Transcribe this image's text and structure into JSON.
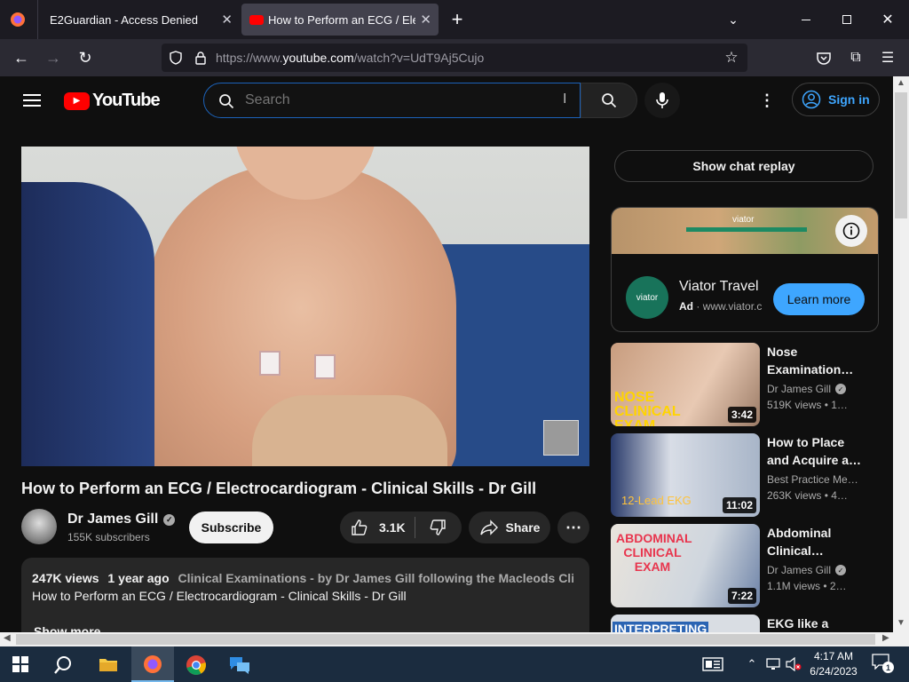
{
  "browser": {
    "tabs": [
      {
        "title": "E2Guardian - Access Denied"
      },
      {
        "title": "How to Perform an ECG / Electr"
      }
    ],
    "url_prefix": "https://www.",
    "url_host": "youtube.com",
    "url_rest": "/watch?v=UdT9Aj5Cujo"
  },
  "youtube": {
    "logo_text": "YouTube",
    "search_placeholder": "Search",
    "sign_in": "Sign in",
    "video_title": "How to Perform an ECG / Electrocardiogram - Clinical Skills - Dr Gill",
    "channel_name": "Dr James Gill",
    "subscribers": "155K subscribers",
    "subscribe": "Subscribe",
    "likes": "3.1K",
    "share": "Share",
    "views": "247K views",
    "age": "1 year ago",
    "desc_tags": "Clinical Examinations - by Dr James Gill following the Macleods Clinical E",
    "desc_line": "How to Perform an ECG / Electrocardiogram - Clinical Skills - Dr Gill",
    "show_more": "Show more",
    "chat_replay": "Show chat replay",
    "ad": {
      "brand": "Viator Travel",
      "label": "Ad",
      "domain": "www.viator.c",
      "cta": "Learn more",
      "logo_text": "viator"
    },
    "related": [
      {
        "title": "Nose Examination…",
        "channel": "Dr James Gill",
        "verified": true,
        "meta": "519K views • 1…",
        "duration": "3:42",
        "thumb_text": "NOSE CLINICAL EXAM"
      },
      {
        "title": "How to Place and Acquire a…",
        "channel": "Best Practice Me…",
        "verified": false,
        "meta": "263K views • 4…",
        "duration": "11:02",
        "thumb_text": "12-Lead EKG"
      },
      {
        "title": "Abdominal Clinical…",
        "channel": "Dr James Gill",
        "verified": true,
        "meta": "1.1M views • 2…",
        "duration": "7:22",
        "thumb_text": "ABDOMINAL CLINICAL EXAM"
      },
      {
        "title": "EKG like a",
        "thumb_text": "INTERPRETING"
      }
    ]
  },
  "taskbar": {
    "time": "4:17 AM",
    "date": "6/24/2023",
    "notifications": "1"
  }
}
